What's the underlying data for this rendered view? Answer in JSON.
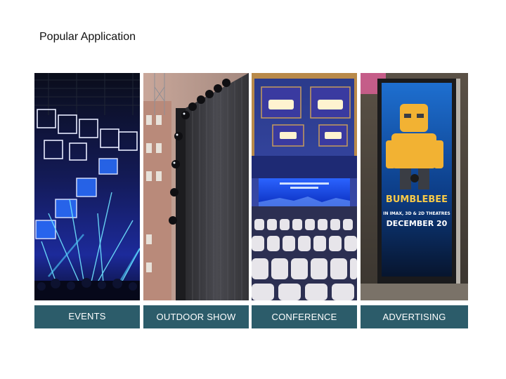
{
  "slide": {
    "title": "Popular Application"
  },
  "panels": [
    {
      "label": "EVENTS"
    },
    {
      "label": "OUTDOOR SHOW"
    },
    {
      "label": "CONFERENCE"
    },
    {
      "label": "ADVERTISING"
    }
  ],
  "poster": {
    "headline": "BUMBLEBEE",
    "subline": "IN IMAX, 3D & 2D THEATRES",
    "date": "DECEMBER 20"
  },
  "colors": {
    "label_bg": "#2c5c6a",
    "label_text": "#ffffff"
  }
}
